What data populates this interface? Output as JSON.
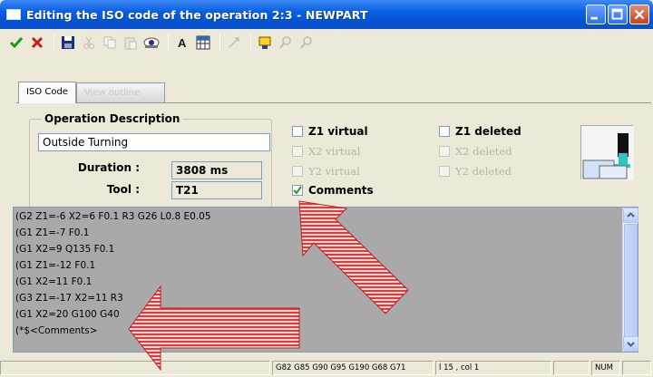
{
  "window": {
    "title": "Editing the ISO code of the operation 2:3 - NEWPART"
  },
  "toolbar": {
    "icons": [
      "check-icon",
      "x-icon",
      "save-icon",
      "cut-icon",
      "copy-icon",
      "paste-icon",
      "eye-icon",
      "font-icon",
      "table-icon",
      "tool-icon",
      "bulb-icon",
      "find-icon",
      "find-next-icon"
    ]
  },
  "tabs": [
    {
      "label": "ISO Code",
      "active": true
    },
    {
      "label": "View outline",
      "active": false
    }
  ],
  "operation": {
    "legend": "Operation Description",
    "description": "Outside Turning",
    "duration_label": "Duration :",
    "duration_value": "3808 ms",
    "tool_label": "Tool :",
    "tool_value": "T21"
  },
  "checkboxes": {
    "z1_virtual": {
      "label": "Z1 virtual",
      "checked": false,
      "enabled": true
    },
    "x2_virtual": {
      "label": "X2 virtual",
      "checked": false,
      "enabled": false
    },
    "y2_virtual": {
      "label": "Y2 virtual",
      "checked": false,
      "enabled": false
    },
    "comments": {
      "label": "Comments",
      "checked": true,
      "enabled": true
    },
    "z1_deleted": {
      "label": "Z1 deleted",
      "checked": false,
      "enabled": true
    },
    "x2_deleted": {
      "label": "X2 deleted",
      "checked": false,
      "enabled": false
    },
    "y2_deleted": {
      "label": "Y2 deleted",
      "checked": false,
      "enabled": false
    }
  },
  "code_lines": [
    "(G2 Z1=-6 X2=6 F0.1 R3 G26 L0.8 E0.05",
    "(G1 Z1=-7 F0.1",
    "(G1 X2=9 Q135 F0.1",
    "(G1 Z1=-12 F0.1",
    "(G1 X2=11 F0.1",
    "(G3 Z1=-17 X2=11 R3",
    "(G1 X2=20 G100 G40",
    "(*$<Comments>"
  ],
  "statusbar": {
    "gcodes": "G82 G85 G90 G95 G190 G68 G71",
    "position": "l  15 , col  1",
    "num": "NUM"
  },
  "colors": {
    "titlebar": "#0a5fe0",
    "code_background": "#a9a9a9",
    "arrow": "#e03a3a"
  }
}
